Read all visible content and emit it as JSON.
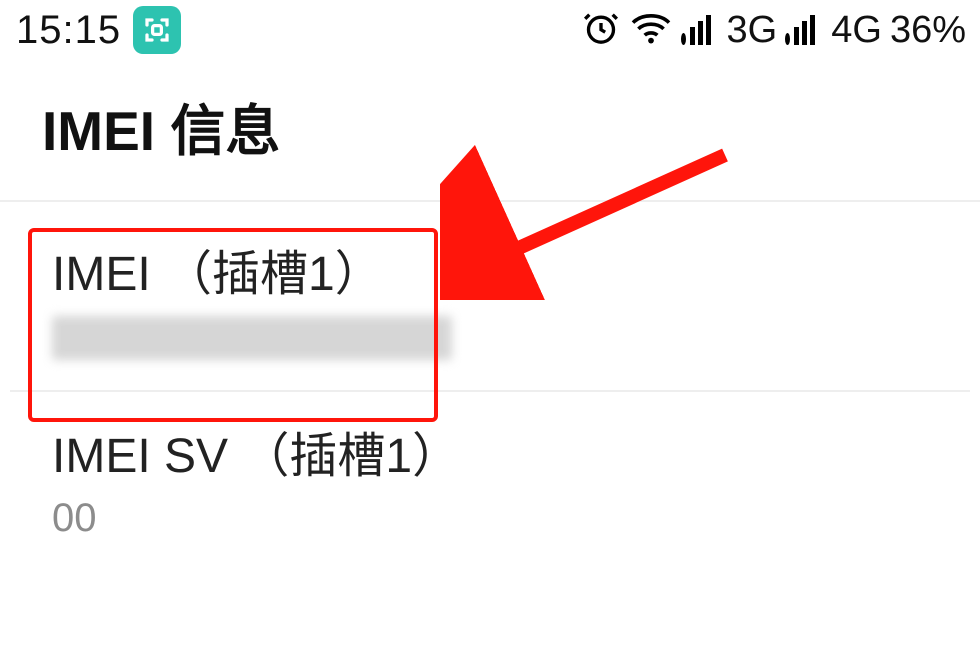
{
  "statusbar": {
    "time": "15:15",
    "net3g_label": "3G",
    "net4g_label": "4G",
    "battery_label": "36%"
  },
  "header": {
    "title": "IMEI 信息"
  },
  "items": {
    "imei_slot1": {
      "label": "IMEI （插槽1）"
    },
    "imeisv_slot1": {
      "label": "IMEI SV （插槽1）",
      "value": "00"
    }
  }
}
